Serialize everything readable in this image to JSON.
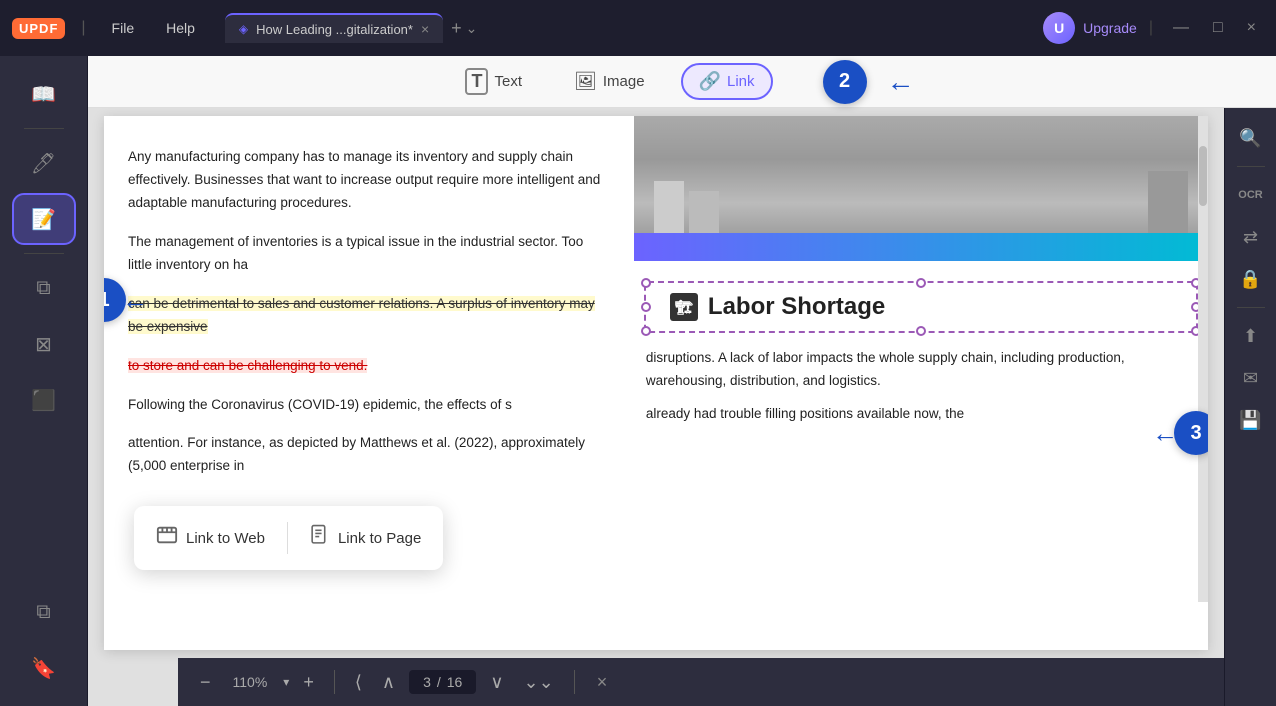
{
  "app": {
    "logo": "UPDF",
    "menu": [
      "File",
      "Help"
    ],
    "tab": {
      "icon": "◈",
      "title": "How Leading ...gitalization*",
      "close_label": "×"
    },
    "tab_add": "+",
    "tab_chevron": "⌄",
    "upgrade_label": "Upgrade",
    "user_initial": "U",
    "win_minimize": "—",
    "win_maximize": "□",
    "win_close": "×"
  },
  "sidebar": {
    "items": [
      {
        "id": "reading",
        "icon": "📖",
        "label": ""
      },
      {
        "id": "annotate",
        "icon": "✏️",
        "label": ""
      },
      {
        "id": "edit",
        "icon": "📝",
        "label": ""
      },
      {
        "id": "copy",
        "icon": "⧉",
        "label": ""
      },
      {
        "id": "crop",
        "icon": "⊠",
        "label": ""
      },
      {
        "id": "redact",
        "icon": "⬛",
        "label": ""
      }
    ],
    "bottom_items": [
      {
        "id": "layers",
        "icon": "⧉"
      },
      {
        "id": "bookmark",
        "icon": "🔖"
      }
    ]
  },
  "toolbar": {
    "text_label": "Text",
    "text_icon": "T",
    "image_label": "Image",
    "image_icon": "🖼",
    "link_label": "Link",
    "link_icon": "🔗"
  },
  "content": {
    "paragraph1": "Any manufacturing company has to manage its inventory and supply chain effectively. Businesses that want to increase output require more intelligent and adaptable manufacturing procedures.",
    "paragraph2": "The management of inventories is a typical issue in the industrial sector. Too little inventory on ha",
    "highlight_yellow": "can be detrimental to sales and customer relations. A surplus of inventory may be expensive",
    "highlight_red": "to store and can be challenging to vend.",
    "paragraph3": "Following the Coronavirus (COVID-19) epidemic, the effects of s",
    "paragraph3b": "attention. For instance, as depicted by Matthews et al. (2022), approximately (5,000 enterprise in",
    "right_text": "disruptions. A lack of labor impacts the whole supply chain, including production, warehousing, distribution, and logistics.",
    "right_text2": "already had trouble filling positions available  now, the",
    "labor_shortage_text": "Labor Shortage",
    "labor_icon": "🏗",
    "annotations": {
      "circle1": "1",
      "circle2": "2",
      "circle3": "3"
    }
  },
  "link_menu": {
    "web_label": "Link to Web",
    "web_icon": "🔗",
    "page_label": "Link to Page",
    "page_icon": "📄"
  },
  "bottom_toolbar": {
    "zoom_out_icon": "−",
    "zoom_value": "110%",
    "zoom_dropdown": "▾",
    "zoom_in_icon": "+",
    "nav_first": "⟨",
    "nav_prev_top": "∧",
    "nav_prev": "⌃",
    "page_current": "3",
    "page_sep": "/",
    "page_total": "16",
    "nav_next": "⌄",
    "nav_next_bottom": "∨",
    "close_icon": "×"
  },
  "right_sidebar": {
    "items": [
      {
        "id": "search",
        "icon": "🔍"
      },
      {
        "id": "ocr",
        "icon": "OCR"
      },
      {
        "id": "convert",
        "icon": "⇄"
      },
      {
        "id": "protect",
        "icon": "🔒"
      },
      {
        "id": "share",
        "icon": "⬆"
      },
      {
        "id": "mail",
        "icon": "✉"
      },
      {
        "id": "save",
        "icon": "💾"
      }
    ]
  }
}
